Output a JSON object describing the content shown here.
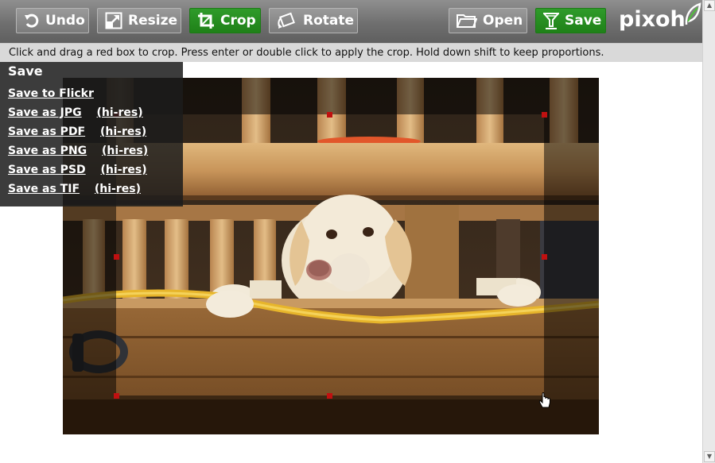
{
  "toolbar": {
    "undo": "Undo",
    "resize": "Resize",
    "crop": "Crop",
    "rotate": "Rotate",
    "open": "Open",
    "save": "Save",
    "logo": "pixoh"
  },
  "hint": "Click and drag a red box to crop. Press enter or double click to apply the crop. Hold down shift to keep proportions.",
  "save_menu": {
    "title": "Save",
    "flickr": "Save to Flickr",
    "items": [
      {
        "label": "Save as JPG",
        "hires": "(hi-res)"
      },
      {
        "label": "Save as PDF",
        "hires": "(hi-res)"
      },
      {
        "label": "Save as PNG",
        "hires": "(hi-res)"
      },
      {
        "label": "Save as PSD",
        "hires": "(hi-res)"
      },
      {
        "label": "Save as TIF",
        "hires": "(hi-res)"
      }
    ]
  },
  "colors": {
    "active_button": "#2a9424",
    "crop_handle": "#c01010",
    "toolbar": "#7a7a7a"
  },
  "icons": [
    "undo-icon",
    "resize-icon",
    "crop-icon",
    "rotate-icon",
    "folder-icon",
    "save-icon",
    "leaf-icon",
    "hand-cursor-icon"
  ]
}
